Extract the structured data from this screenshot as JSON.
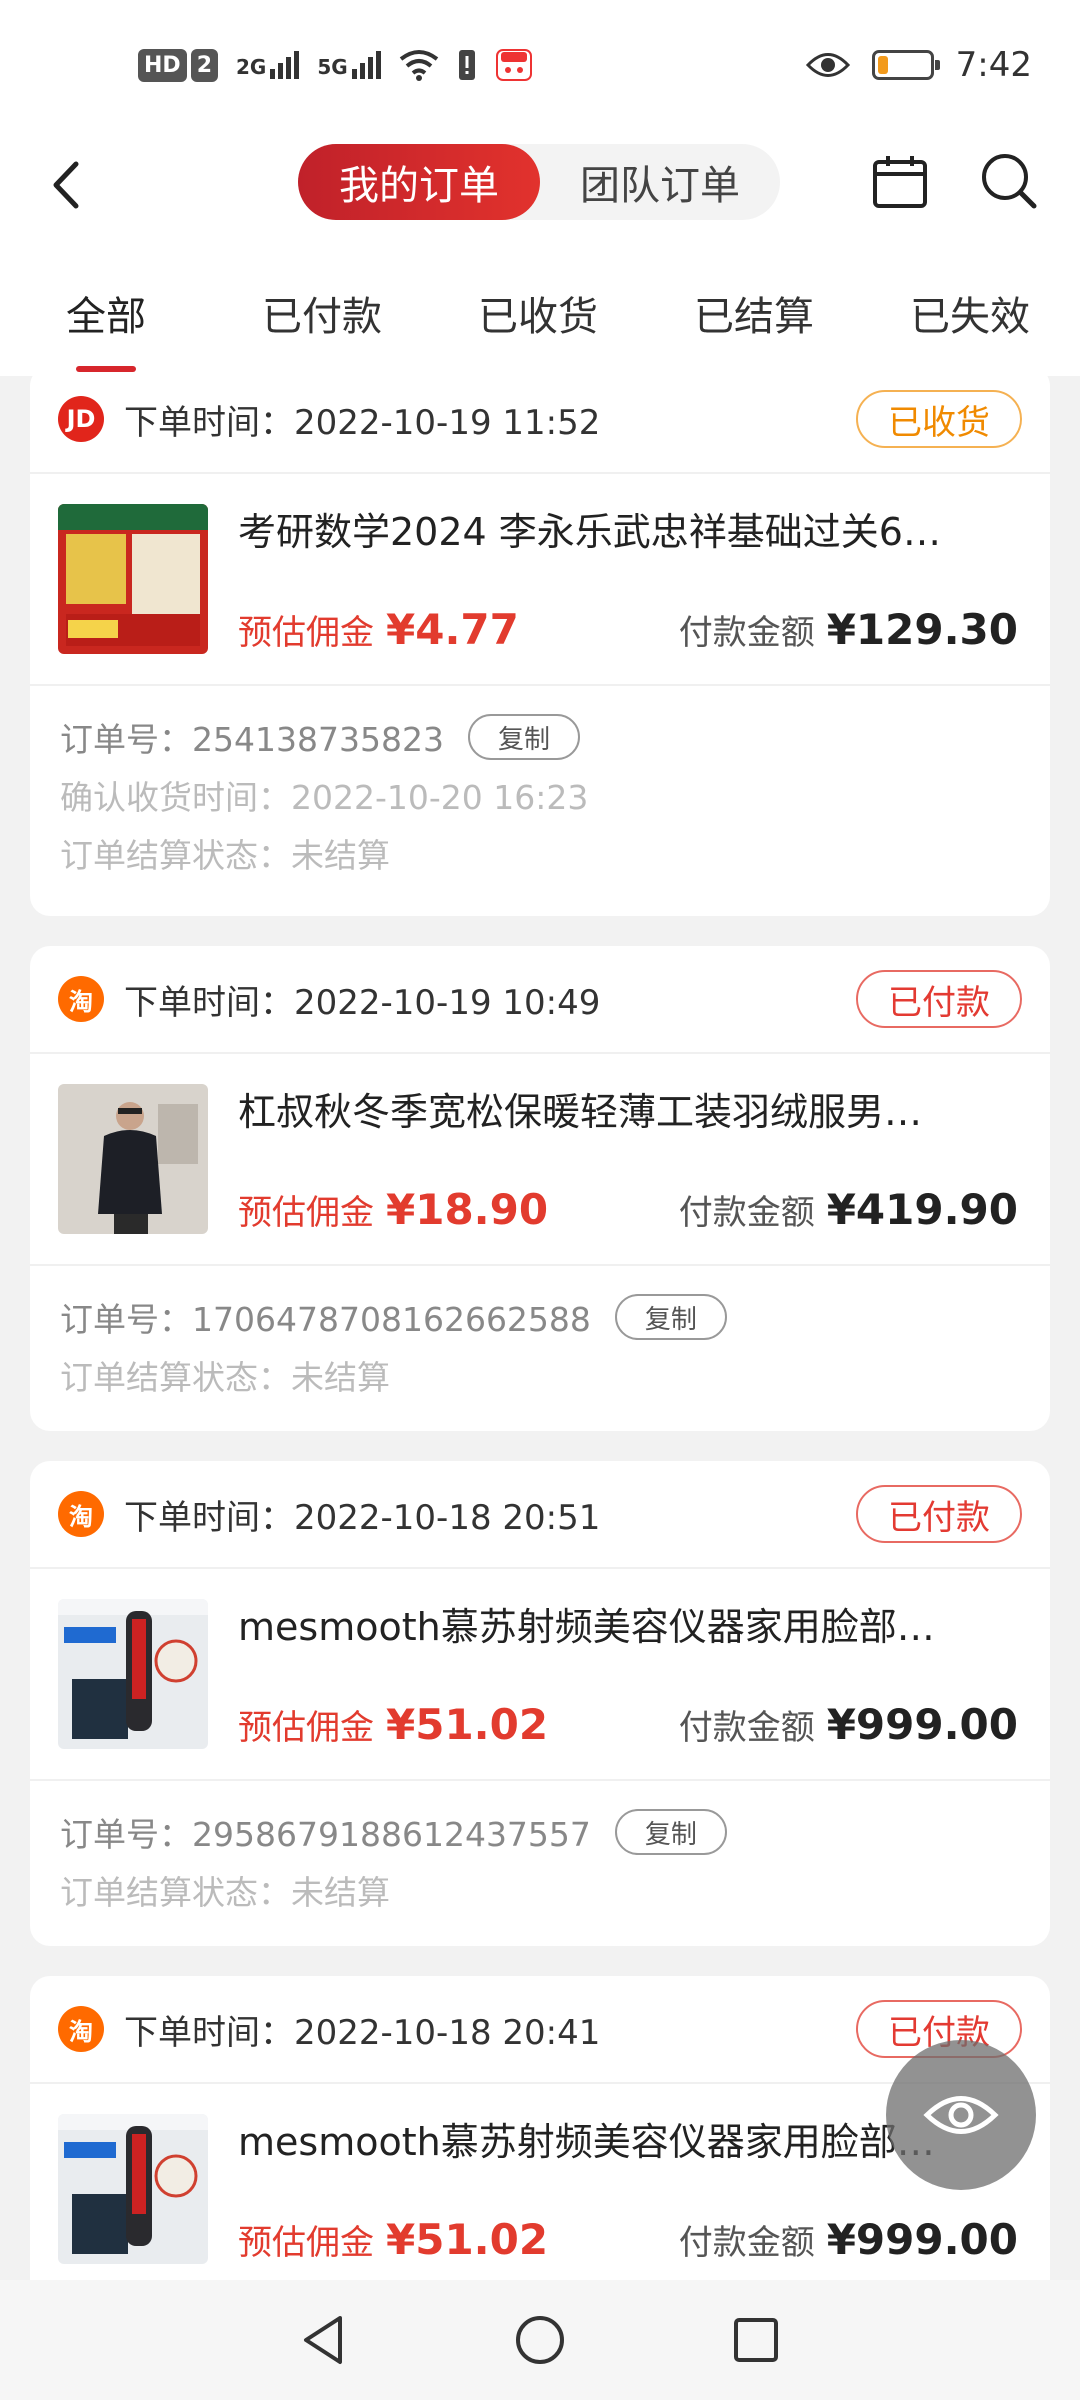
{
  "status_bar": {
    "hd": "HD",
    "sim": "2",
    "net1": "2G",
    "net2": "5G",
    "time": "7:42"
  },
  "header": {
    "seg_active": "我的订单",
    "seg_inactive": "团队订单"
  },
  "tabs": [
    {
      "label": "全部",
      "active": true
    },
    {
      "label": "已付款",
      "active": false
    },
    {
      "label": "已收货",
      "active": false
    },
    {
      "label": "已结算",
      "active": false
    },
    {
      "label": "已失效",
      "active": false
    }
  ],
  "orders": [
    {
      "store": "JD",
      "time_label": "下单时间：2022-10-19 11:52",
      "status": "已收货",
      "title": "考研数学2024 李永乐武忠祥基础过关6…",
      "commission_label": "预估佣金",
      "commission": "¥4.77",
      "pay_label": "付款金额",
      "pay": "¥129.30",
      "order_no": "订单号：254138735823",
      "copy": "复制",
      "extra1": "确认收货时间：2022-10-20 16:23",
      "extra2": "订单结算状态：未结算"
    },
    {
      "store": "淘",
      "time_label": "下单时间：2022-10-19 10:49",
      "status": "已付款",
      "title": "杠叔秋冬季宽松保暖轻薄工装羽绒服男…",
      "commission_label": "预估佣金",
      "commission": "¥18.90",
      "pay_label": "付款金额",
      "pay": "¥419.90",
      "order_no": "订单号：1706478708162662588",
      "copy": "复制",
      "extra1": "订单结算状态：未结算"
    },
    {
      "store": "淘",
      "time_label": "下单时间：2022-10-18 20:51",
      "status": "已付款",
      "title": "mesmooth慕苏射频美容仪器家用脸部…",
      "commission_label": "预估佣金",
      "commission": "¥51.02",
      "pay_label": "付款金额",
      "pay": "¥999.00",
      "order_no": "订单号：2958679188612437557",
      "copy": "复制",
      "extra1": "订单结算状态：未结算"
    },
    {
      "store": "淘",
      "time_label": "下单时间：2022-10-18 20:41",
      "status": "已付款",
      "title": "mesmooth慕苏射频美容仪器家用脸部…",
      "commission_label": "预估佣金",
      "commission": "¥51.02",
      "pay_label": "付款金额",
      "pay": "¥999.00"
    }
  ],
  "colors": {
    "accent": "#d7262c",
    "commission": "#e23b2e",
    "received_tag": "#f08a00",
    "paid_tag": "#e33a32"
  }
}
